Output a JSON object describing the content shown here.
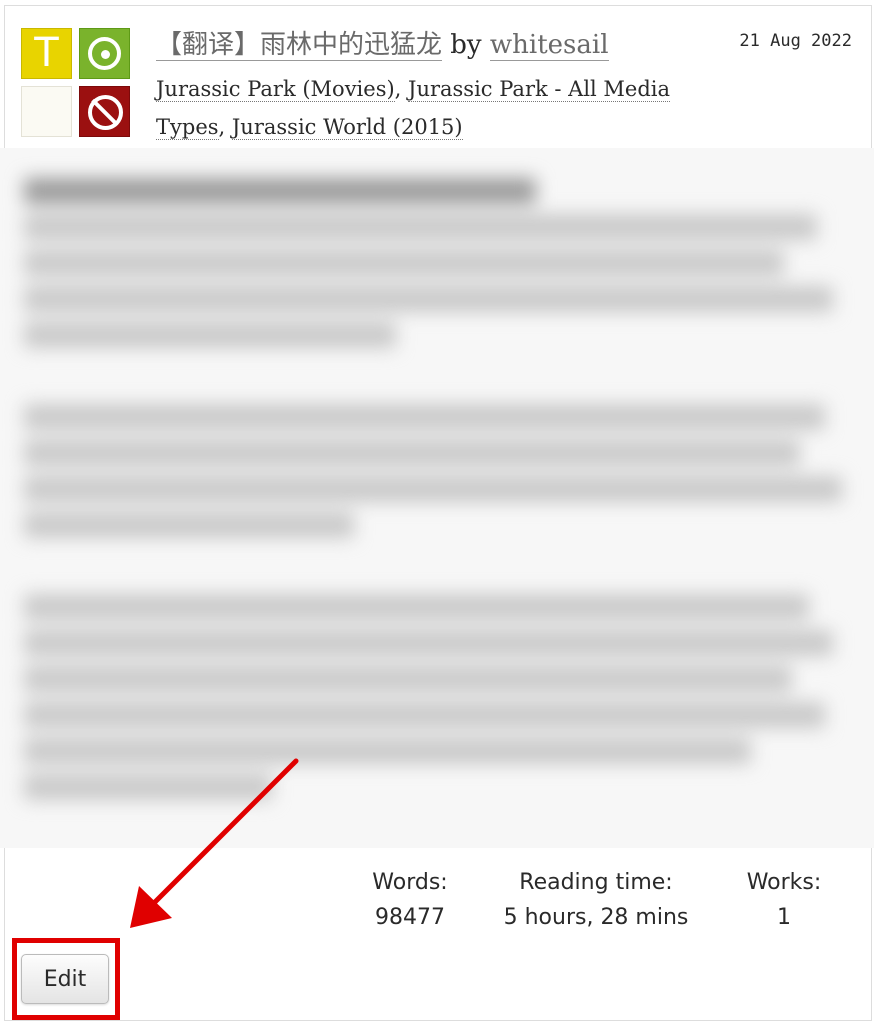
{
  "work": {
    "title": "【翻译】雨林中的迅猛龙",
    "by_label": "by",
    "author": "whitesail",
    "date": "21 Aug 2022",
    "rating_icon_letter": "T",
    "fandoms_sep": ", ",
    "fandoms": [
      "Jurassic Park (Movies)",
      "Jurassic Park - All Media Types",
      "Jurassic World (2015)"
    ]
  },
  "stats": {
    "words_label": "Words:",
    "words_value": "98477",
    "reading_time_label": "Reading time:",
    "reading_time_value": "5 hours, 28 mins",
    "works_label": "Works:",
    "works_value": "1"
  },
  "actions": {
    "edit_label": "Edit"
  },
  "colors": {
    "annotation": "#e00000",
    "rating_icon": "#e8d400",
    "category_icon": "#7ab32c",
    "complete_icon": "#9b1010"
  },
  "icons": [
    "rating-icon",
    "category-icon",
    "warning-icon",
    "complete-icon"
  ]
}
